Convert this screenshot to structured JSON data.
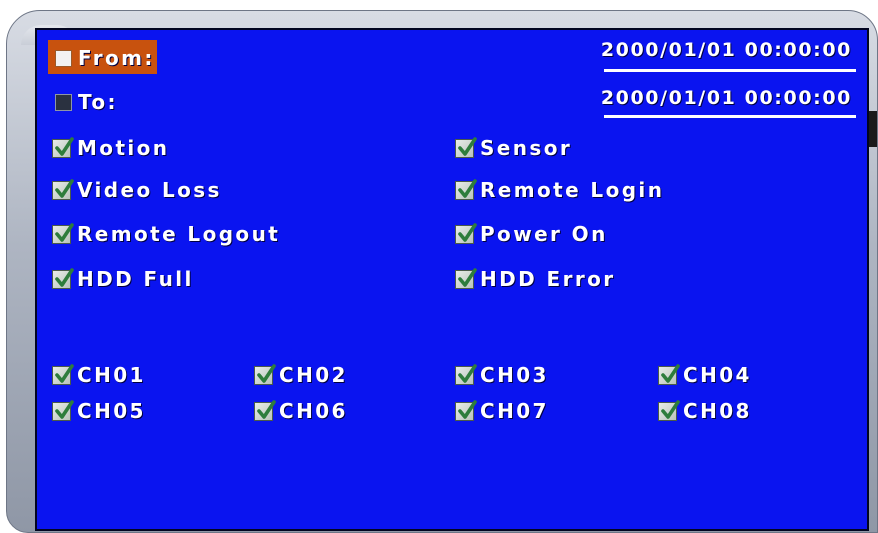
{
  "time_range": {
    "from_label": "From:",
    "to_label": "To:",
    "from_value": "2000/01/01 00:00:00",
    "to_value": "2000/01/01 00:00:00",
    "from_checked": false,
    "to_checked": false
  },
  "events": [
    {
      "label": "Motion",
      "checked": true
    },
    {
      "label": "Sensor",
      "checked": true
    },
    {
      "label": "Video Loss",
      "checked": true
    },
    {
      "label": "Remote Login",
      "checked": true
    },
    {
      "label": "Remote Logout",
      "checked": true
    },
    {
      "label": "Power On",
      "checked": true
    },
    {
      "label": "HDD Full",
      "checked": true
    },
    {
      "label": "HDD Error",
      "checked": true
    }
  ],
  "channels": [
    {
      "label": "CH01",
      "checked": true
    },
    {
      "label": "CH02",
      "checked": true
    },
    {
      "label": "CH03",
      "checked": true
    },
    {
      "label": "CH04",
      "checked": true
    },
    {
      "label": "CH05",
      "checked": true
    },
    {
      "label": "CH06",
      "checked": true
    },
    {
      "label": "CH07",
      "checked": true
    },
    {
      "label": "CH08",
      "checked": true
    }
  ],
  "colors": {
    "panel_background": "#0a14f0",
    "focus_highlight": "#c8520e",
    "text": "#ffffff",
    "checkmark": "#2e7d3c"
  },
  "icons": {
    "checkbox_checked": "checkmark-checkbox-icon"
  }
}
